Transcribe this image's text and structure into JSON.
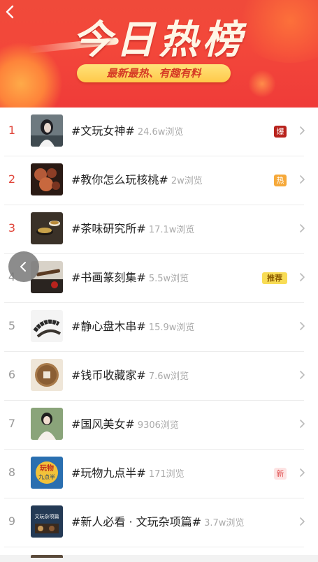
{
  "banner": {
    "title": "今日热榜",
    "subtitle": "最新最热、有趣有料"
  },
  "items": [
    {
      "rank": "1",
      "title": "#文玩女神#",
      "views": "24.6w浏览",
      "badge": "爆",
      "badge_type": "bao",
      "thumb": "woman-portrait"
    },
    {
      "rank": "2",
      "title": "#教你怎么玩核桃#",
      "views": "2w浏览",
      "badge": "热",
      "badge_type": "hot",
      "thumb": "walnut-beads"
    },
    {
      "rank": "3",
      "title": "#茶味研究所#",
      "views": "17.1w浏览",
      "badge": "",
      "badge_type": "",
      "thumb": "tea-cup"
    },
    {
      "rank": "4",
      "title": "#书画篆刻集#",
      "views": "5.5w浏览",
      "badge": "推荐",
      "badge_type": "rec",
      "thumb": "ink-brush"
    },
    {
      "rank": "5",
      "title": "#静心盘木串#",
      "views": "15.9w浏览",
      "badge": "",
      "badge_type": "",
      "thumb": "wood-beads"
    },
    {
      "rank": "6",
      "title": "#钱币收藏家#",
      "views": "7.6w浏览",
      "badge": "",
      "badge_type": "",
      "thumb": "coin"
    },
    {
      "rank": "7",
      "title": "#国风美女#",
      "views": "9306浏览",
      "badge": "",
      "badge_type": "",
      "thumb": "hanfu-girl"
    },
    {
      "rank": "8",
      "title": "#玩物九点半#",
      "views": "171浏览",
      "badge": "新",
      "badge_type": "new",
      "thumb": "poster"
    },
    {
      "rank": "9",
      "title": "#新人必看 · 文玩杂项篇#",
      "views": "3.7w浏览",
      "badge": "",
      "badge_type": "",
      "thumb": "guide-cover"
    }
  ],
  "thumbnail_text": {
    "item8_top": "玩物",
    "item8_bottom": "九点半",
    "item9_cover": "文玩杂项篇"
  },
  "colors": {
    "banner_red": "#f04a3a",
    "rank_top": "#e0453a",
    "badge_bao": "#b8231d",
    "badge_hot": "#f6a93a",
    "badge_rec": "#f8dc55",
    "badge_new": "#fde3e3"
  },
  "icons": {
    "back": "chevron-left-icon",
    "row_arrow": "chevron-right-icon",
    "float_back": "chevron-left-icon"
  }
}
